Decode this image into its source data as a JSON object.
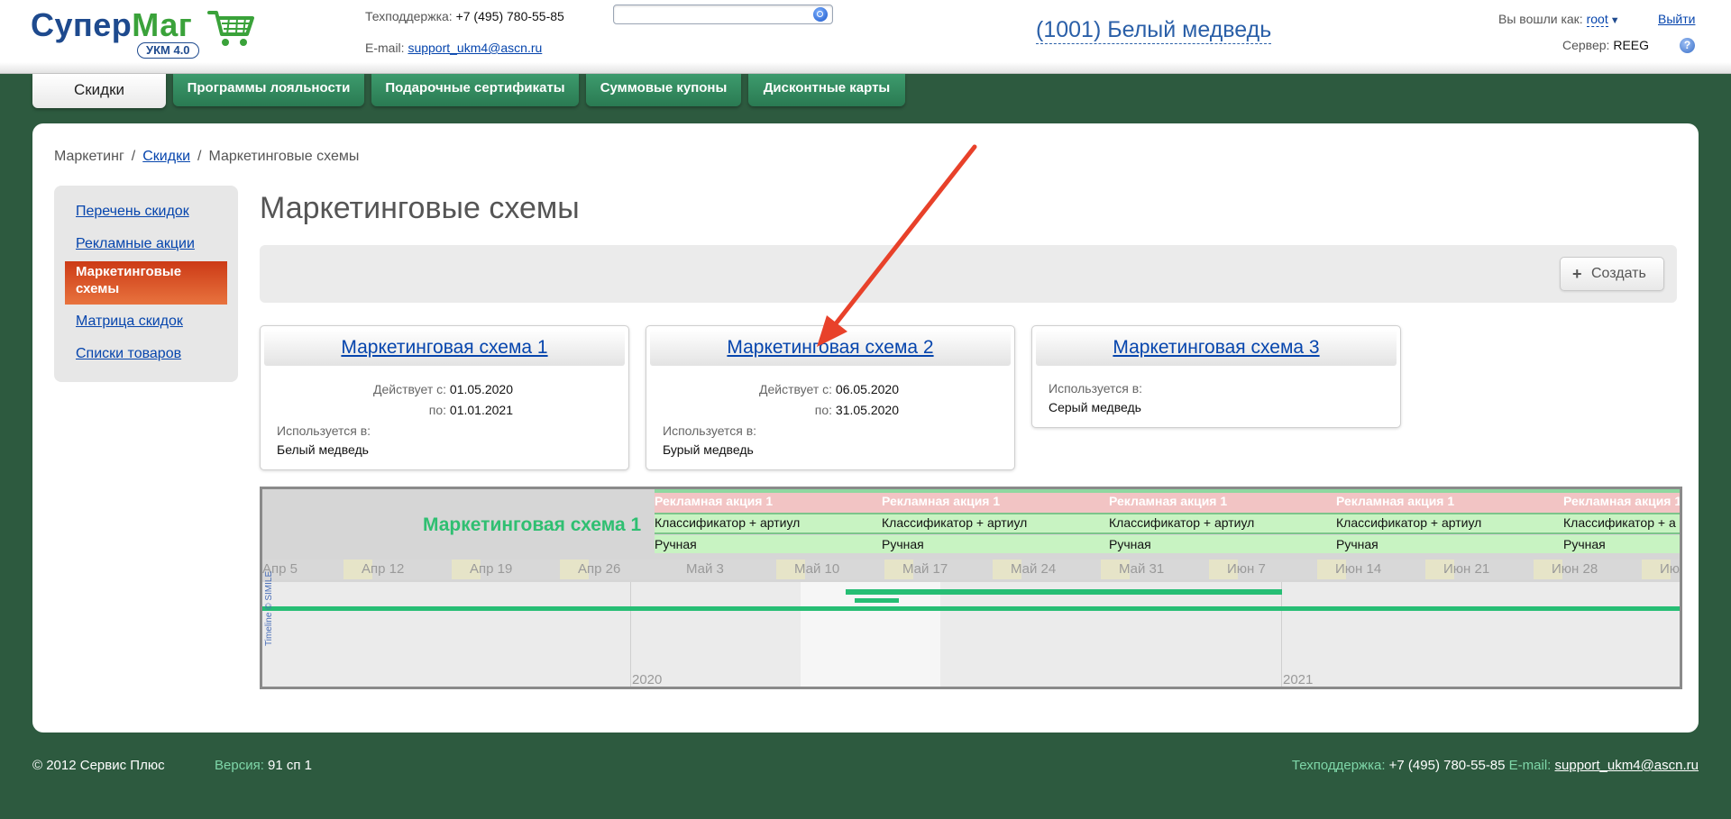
{
  "header": {
    "logo": {
      "part1": "Супер",
      "part2": "Маг",
      "badge": "УКМ 4.0"
    },
    "support_label": "Техподдержка:",
    "support_phone": "+7 (495) 780-55-85",
    "email_label": "E-mail:",
    "email": "support_ukm4@ascn.ru",
    "search": {
      "value": "",
      "placeholder": ""
    },
    "store": "(1001) Белый медведь",
    "login_label": "Вы вошли как:",
    "login_user": "root",
    "logout": "Выйти",
    "server_label": "Сервер:",
    "server_value": "REEG"
  },
  "nav": {
    "tabs": [
      {
        "label": "Скидки",
        "active": true
      },
      {
        "label": "Программы лояльности"
      },
      {
        "label": "Подарочные сертификаты"
      },
      {
        "label": "Суммовые купоны"
      },
      {
        "label": "Дисконтные карты"
      }
    ]
  },
  "breadcrumb": {
    "root": "Маркетинг",
    "link": "Скидки",
    "current": "Маркетинговые схемы"
  },
  "sidebar": {
    "items": [
      {
        "label": "Перечень скидок"
      },
      {
        "label": "Рекламные акции"
      },
      {
        "label": "Маркетинговые схемы",
        "active": true
      },
      {
        "label": "Матрица скидок"
      },
      {
        "label": "Списки товаров"
      }
    ]
  },
  "page": {
    "title": "Маркетинговые схемы",
    "create_button": "Создать"
  },
  "cards": [
    {
      "title": "Маркетинговая схема 1",
      "from_label": "Действует с:",
      "from": "01.05.2020",
      "to_label": "по:",
      "to": "01.01.2021",
      "used_label": "Используется в:",
      "used_in": "Белый медведь"
    },
    {
      "title": "Маркетинговая схема 2",
      "from_label": "Действует с:",
      "from": "06.05.2020",
      "to_label": "по:",
      "to": "31.05.2020",
      "used_label": "Используется в:",
      "used_in": "Бурый медведь"
    },
    {
      "title": "Маркетинговая схема 3",
      "used_label": "Используется в:",
      "used_in": "Серый медведь"
    }
  ],
  "timeline": {
    "scheme_label": "Маркетинговая схема 1",
    "promo": "Рекламная акция 1",
    "promo_cut": "Рекламная акция 1",
    "classifier": "Классификатор + артиул",
    "classifier_cut": "Классификатор + а",
    "mode": "Ручная",
    "weeks": [
      "Апр 5",
      "Апр 12",
      "Апр 19",
      "Апр 26",
      "Май 3",
      "Май 10",
      "Май 17",
      "Май 24",
      "Май 31",
      "Июн 7",
      "Июн 14",
      "Июн 21",
      "Июн 28",
      "Июл"
    ],
    "years": [
      "2020",
      "2021"
    ],
    "credit": "Timeline © SIMILE"
  },
  "footer": {
    "copyright": "© 2012 Сервис Плюс",
    "version_label": "Версия:",
    "version": "91 сп 1",
    "support_label": "Техподдержка:",
    "support_phone": "+7 (495) 780-55-85",
    "email_label": "E-mail:",
    "email": "support_ukm4@ascn.ru"
  },
  "colors": {
    "background": "#2d5a3f",
    "tab_green": "#3d9b6d",
    "active_sidebar": "#cc3a16",
    "link": "#0645ad",
    "timeline_green": "#26be74",
    "arrow": "#e8412a"
  }
}
